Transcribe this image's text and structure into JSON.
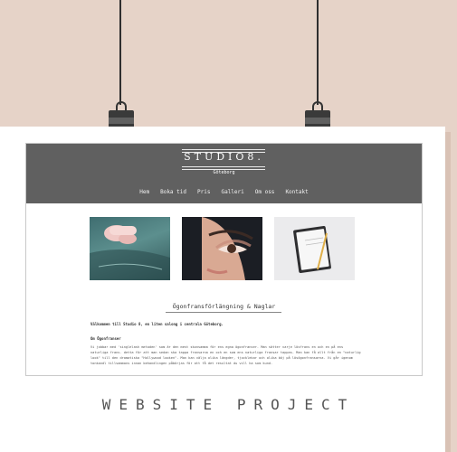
{
  "site": {
    "logo": "STUDIO8.",
    "city": "Göteborg",
    "nav": [
      "Hem",
      "Boka tid",
      "Pris",
      "Galleri",
      "Om oss",
      "Kontakt"
    ],
    "heading": "Ögonfransförlängning & Naglar",
    "welcome": "Välkommen till Studio 8, en liten salong i centrala Göteborg.",
    "subheading": "Om Ögonfranser",
    "paragraph": "Vi jobbar med 'singlelash metoden' som är den mest skonsamma för ens egna ögonfranser. Man sätter varje lösfrans en och en på ens naturliga frans. detta för att man sedan ska tappa fransarna en och en som ens naturliga fransar tappas. Man kan få allt från en \"naturlig look\" till den dramatiska \"Hollywood looken\". Man kan välja olika längder, tjocklekar och olika böj på lösögonfransarna. Vi går igenom tonkandl tillsammans innan behandlingen påbörjas för att få det resultat du vill ha som kund."
  },
  "caption": "WEBSITE PROJECT"
}
